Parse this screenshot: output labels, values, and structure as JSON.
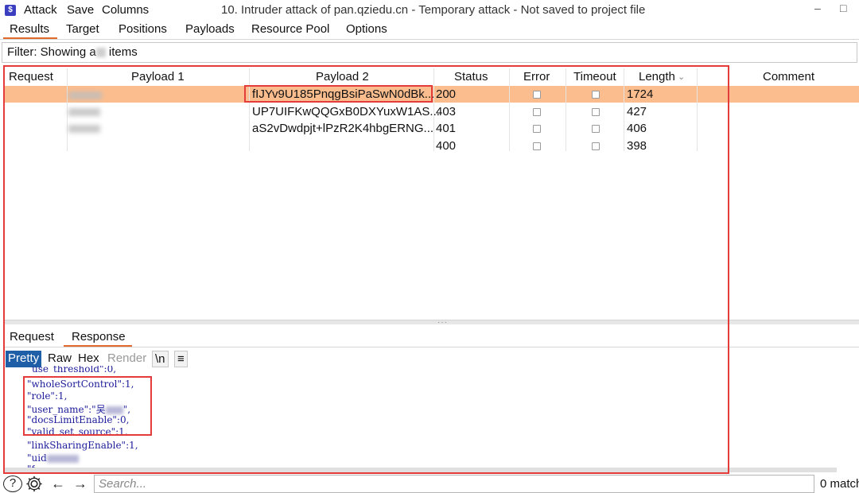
{
  "menu": {
    "attack": "Attack",
    "save": "Save",
    "columns": "Columns"
  },
  "window": {
    "title": "10. Intruder attack of pan.qziedu.cn - Temporary attack - Not saved to project file",
    "minimize": "–",
    "maximize": "□"
  },
  "tabs": [
    "Results",
    "Target",
    "Positions",
    "Payloads",
    "Resource Pool",
    "Options"
  ],
  "filter": {
    "prefix": "Filter: Showing a",
    "suffix": " items"
  },
  "table": {
    "headers": [
      "Request",
      "Payload 1",
      "Payload 2",
      "Status",
      "Error",
      "Timeout",
      "Length",
      "Comment"
    ],
    "sort_indicator": "⌄",
    "rows": [
      {
        "payload2": "fIJYv9U185PnqgBsiPaSwN0dBk...",
        "status": "200",
        "length": "1724"
      },
      {
        "payload2": "UP7UIFKwQQGxB0DXYuxW1AS...",
        "status": "403",
        "length": "427"
      },
      {
        "payload2": "aS2vDwdpjt+lPzR2K4hbgERNG...",
        "status": "401",
        "length": "406"
      },
      {
        "payload2": "",
        "status": "400",
        "length": "398"
      }
    ]
  },
  "lower_tabs": {
    "request": "Request",
    "response": "Response"
  },
  "view_buttons": {
    "pretty": "Pretty",
    "raw": "Raw",
    "hex": "Hex",
    "render": "Render",
    "newline": "\\n",
    "menu": "≡"
  },
  "code_lines": [
    "use_threshold\":0,",
    "\"wholeSortControl\":1,",
    "\"role\":1,",
    "\"user_name\":\"吴",
    "\"docsLimitEnable\":0,",
    "\"valid_set_source\":1,",
    "\"linkSharingEnable\":1,",
    "\"uid",
    "\"f"
  ],
  "bottom": {
    "help": "?",
    "back": "←",
    "forward": "→",
    "search_placeholder": "Search...",
    "match": "0 match"
  },
  "colors": {
    "accent": "#e26a2c",
    "highlight_row": "#fbbd8e",
    "annotation": "#e43b3b",
    "pretty_active": "#1f5fa8"
  }
}
